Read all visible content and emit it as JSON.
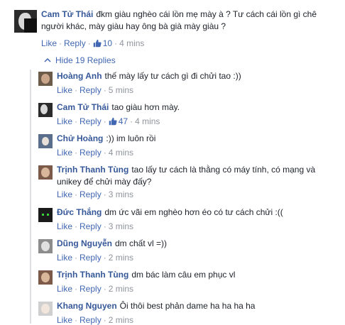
{
  "main": {
    "author": "Cam Tử Thái",
    "text": "đkm giàu nghèo cái lồn mẹ mày à ? Tư cách cái lồn gì chê người khác, mày giàu hay ông bà già mày giàu ?",
    "like_label": "Like",
    "reply_label": "Reply",
    "likes": "10",
    "time": "4 mins"
  },
  "hide_replies_label": "Hide 19 Replies",
  "replies": [
    {
      "author": "Hoàng Anh",
      "text": "thế mày lấy tư cách gì đi chửi tao :))",
      "like_label": "Like",
      "reply_label": "Reply",
      "likes": "",
      "time": "5 mins"
    },
    {
      "author": "Cam Tử Thái",
      "text": "tao giàu hơn mày.",
      "like_label": "Like",
      "reply_label": "Reply",
      "likes": "47",
      "time": "4 mins"
    },
    {
      "author": "Chử Hoàng",
      "text": ":)) im luôn rồi",
      "like_label": "Like",
      "reply_label": "Reply",
      "likes": "",
      "time": "4 mins"
    },
    {
      "author": "Trịnh Thanh Tùng",
      "text": "tao lấy tư cách là thằng có máy tính, có mạng và unikey để chửi mày đấy?",
      "like_label": "Like",
      "reply_label": "Reply",
      "likes": "",
      "time": "3 mins"
    },
    {
      "author": "Đức Thắng",
      "text": "dm ức vãi em nghèo hơn éo có tư cách chửi :((",
      "like_label": "Like",
      "reply_label": "Reply",
      "likes": "",
      "time": "3 mins"
    },
    {
      "author": "Dũng Nguyễn",
      "text": "dm chất vl =))",
      "like_label": "Like",
      "reply_label": "Reply",
      "likes": "",
      "time": "2 mins"
    },
    {
      "author": "Trịnh Thanh Tùng",
      "text": "dm bác làm câu em phục vl",
      "like_label": "Like",
      "reply_label": "Reply",
      "likes": "",
      "time": "2 mins"
    },
    {
      "author": "Khang Nguyen",
      "text": "Ôi thôi best phản dame ha ha ha ha",
      "like_label": "Like",
      "reply_label": "Reply",
      "likes": "",
      "time": "2 mins"
    }
  ],
  "colors": {
    "author": "#365899",
    "link": "#4267b2",
    "meta": "#90949c",
    "text": "#1d2129"
  },
  "icons": [
    "thumbs-up-icon",
    "chevron-up-icon",
    "avatar"
  ]
}
